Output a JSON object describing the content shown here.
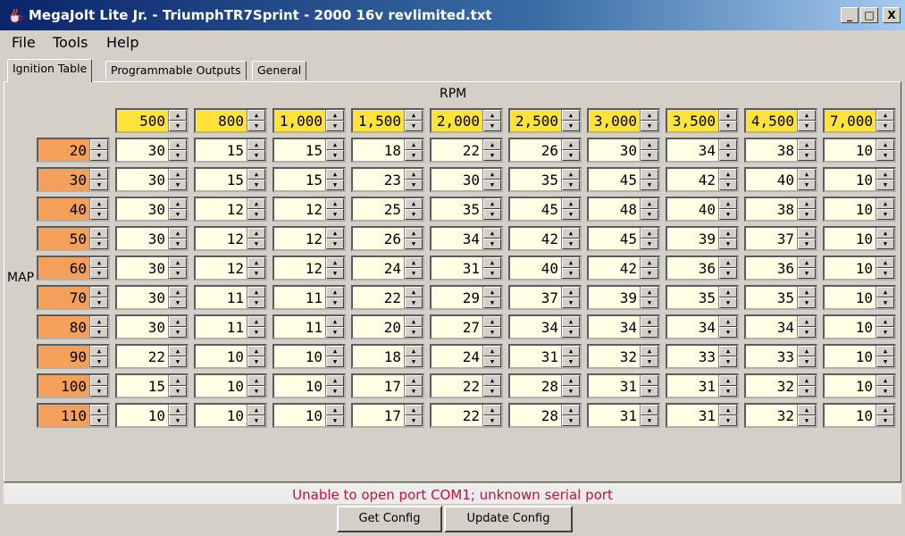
{
  "window": {
    "title": "MegaJolt Lite Jr. - TriumphTR7Sprint - 2000 16v revlimited.txt",
    "controls": {
      "minimize": "_",
      "maximize": "□",
      "close": "X"
    }
  },
  "menu": [
    "File",
    "Tools",
    "Help"
  ],
  "tabs": [
    "Ignition Table",
    "Programmable Outputs",
    "General"
  ],
  "table": {
    "rpm_label": "RPM",
    "map_label": "MAP",
    "rpm_values": [
      "500",
      "800",
      "1,000",
      "1,500",
      "2,000",
      "2,500",
      "3,000",
      "3,500",
      "4,500",
      "7,000"
    ],
    "map_values": [
      "20",
      "30",
      "40",
      "50",
      "60",
      "70",
      "80",
      "90",
      "100",
      "110"
    ],
    "cells": [
      [
        "30",
        "15",
        "15",
        "18",
        "22",
        "26",
        "30",
        "34",
        "38",
        "10"
      ],
      [
        "30",
        "15",
        "15",
        "23",
        "30",
        "35",
        "45",
        "42",
        "40",
        "10"
      ],
      [
        "30",
        "12",
        "12",
        "25",
        "35",
        "45",
        "48",
        "40",
        "38",
        "10"
      ],
      [
        "30",
        "12",
        "12",
        "26",
        "34",
        "42",
        "45",
        "39",
        "37",
        "10"
      ],
      [
        "30",
        "12",
        "12",
        "24",
        "31",
        "40",
        "42",
        "36",
        "36",
        "10"
      ],
      [
        "30",
        "11",
        "11",
        "22",
        "29",
        "37",
        "39",
        "35",
        "35",
        "10"
      ],
      [
        "30",
        "11",
        "11",
        "20",
        "27",
        "34",
        "34",
        "34",
        "34",
        "10"
      ],
      [
        "22",
        "10",
        "10",
        "18",
        "24",
        "31",
        "32",
        "33",
        "33",
        "10"
      ],
      [
        "15",
        "10",
        "10",
        "17",
        "22",
        "28",
        "31",
        "31",
        "32",
        "10"
      ],
      [
        "10",
        "10",
        "10",
        "17",
        "22",
        "28",
        "31",
        "31",
        "32",
        "10"
      ]
    ]
  },
  "status": {
    "message": "Unable to open port COM1; unknown serial port",
    "color": "#c0143c"
  },
  "buttons": {
    "get_config": "Get Config",
    "update_config": "Update Config"
  },
  "colors": {
    "rpm_header": "#ffe23a",
    "map_header": "#f4a05a",
    "cell": "#ffffe6"
  },
  "icons": {
    "app": "java-cup-icon",
    "spin_up": "arrow-up-icon",
    "spin_down": "arrow-down-icon"
  }
}
